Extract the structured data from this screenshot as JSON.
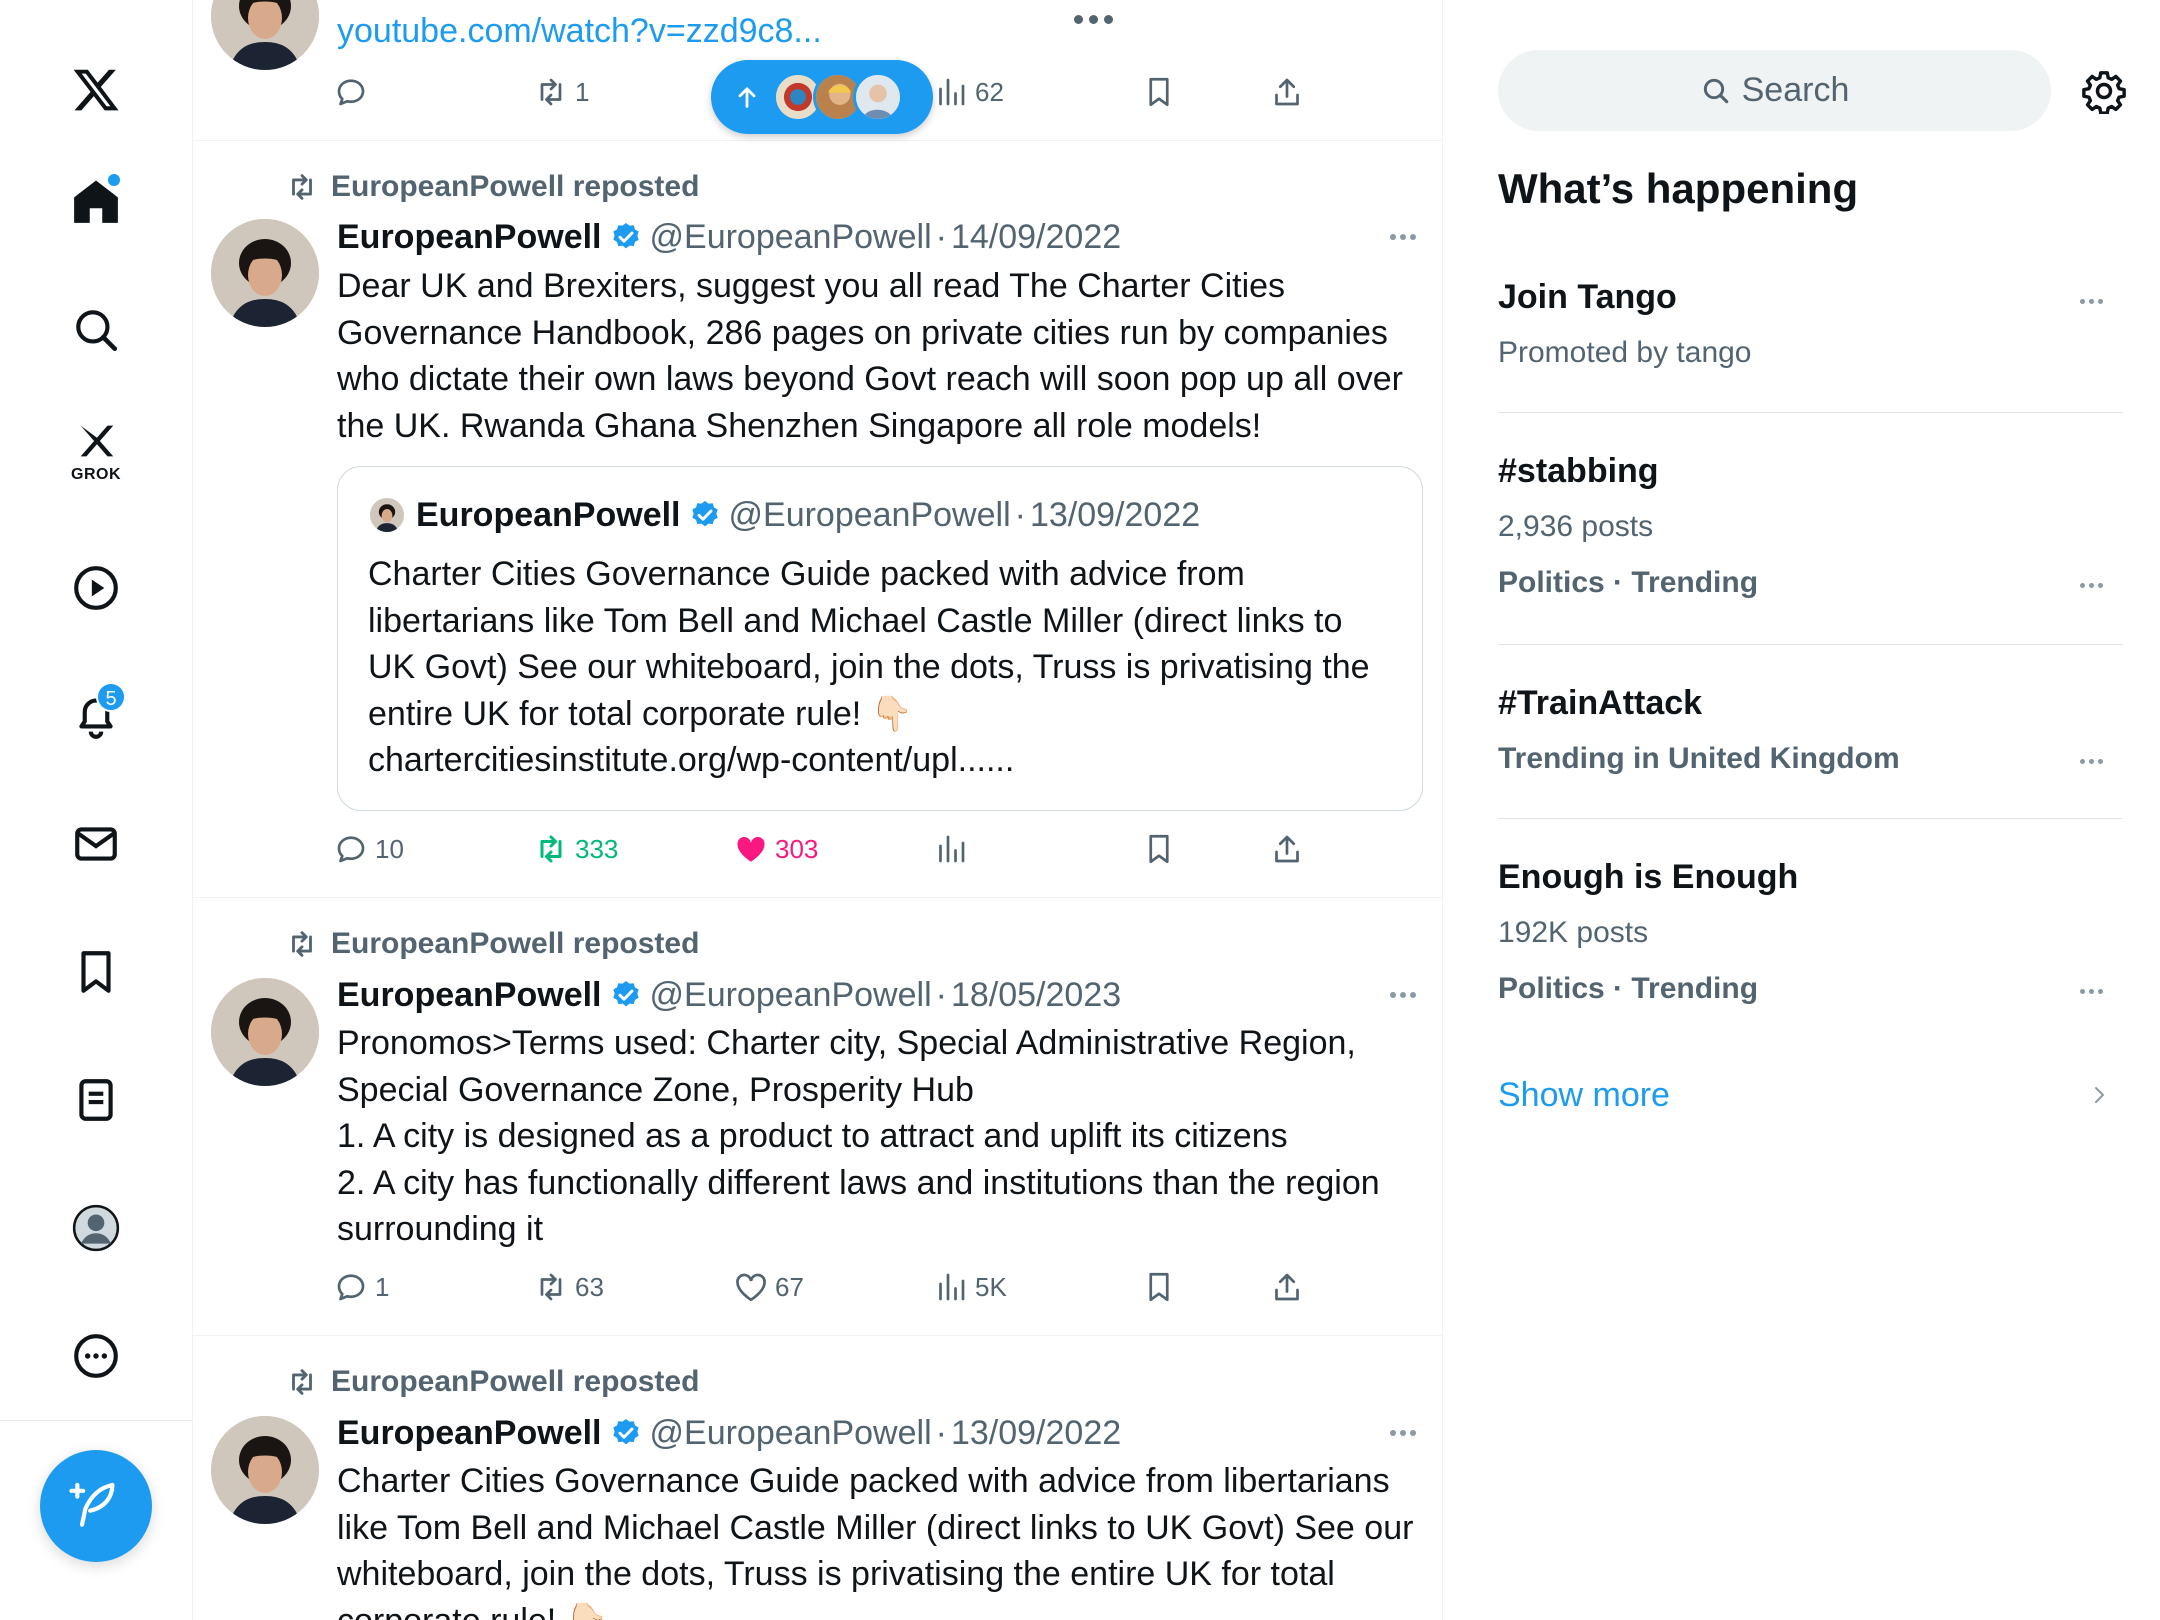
{
  "colors": {
    "accent": "#1d9bf0",
    "text": "#0f1419",
    "muted": "#536471",
    "repost": "#00ba7c",
    "like": "#f91880"
  },
  "nav": {
    "items": [
      {
        "name": "x-logo-icon"
      },
      {
        "name": "home-icon",
        "has_dot": true
      },
      {
        "name": "explore-search-icon"
      },
      {
        "name": "grok-icon",
        "label": "GROK"
      },
      {
        "name": "video-play-icon"
      },
      {
        "name": "notifications-bell-icon",
        "badge": "5"
      },
      {
        "name": "messages-envelope-icon"
      },
      {
        "name": "bookmarks-icon"
      },
      {
        "name": "lists-icon"
      },
      {
        "name": "profile-avatar-icon"
      },
      {
        "name": "more-ellipsis-icon"
      }
    ],
    "compose": {
      "icon": "feather-plus-icon"
    }
  },
  "timeline": {
    "top_post": {
      "link": "youtube.com/watch?v=zzd9c8...",
      "retweets": "1",
      "views": "62"
    },
    "new_posts_pill": {
      "icon": "arrow-up-icon"
    },
    "posts": [
      {
        "reposted_by": "EuropeanPowell reposted",
        "name": "EuropeanPowell",
        "handle": "@EuropeanPowell",
        "sep": "·",
        "date": "14/09/2022",
        "text": "Dear UK and Brexiters, suggest you all read The Charter Cities Governance Handbook, 286 pages on private cities run by companies who dictate their own laws beyond Govt reach will soon pop up all over the UK. Rwanda Ghana Shenzhen Singapore all role models!",
        "quote": {
          "name": "EuropeanPowell",
          "handle": "@EuropeanPowell",
          "sep": "·",
          "date": "13/09/2022",
          "text": "Charter Cities Governance Guide packed with advice from libertarians like Tom Bell and Michael Castle Miller (direct links to UK Govt) See our whiteboard, join the dots, Truss is privatising the entire UK for total corporate rule! 👇🏻",
          "link": "chartercitiesinstitute.org/wp-content/upl......"
        },
        "replies": "10",
        "retweets": "333",
        "likes": "303",
        "views": ""
      },
      {
        "reposted_by": "EuropeanPowell reposted",
        "name": "EuropeanPowell",
        "handle": "@EuropeanPowell",
        "sep": "·",
        "date": "18/05/2023",
        "lines": [
          "Pronomos>Terms used: Charter city, Special Administrative Region, Special Governance Zone, Prosperity Hub",
          "1. A city is designed as a product to attract and uplift its citizens",
          "2. A city has functionally different laws and institutions than the region surrounding it"
        ],
        "replies": "1",
        "retweets": "63",
        "likes": "67",
        "views": "5K"
      },
      {
        "reposted_by": "EuropeanPowell reposted",
        "name": "EuropeanPowell",
        "handle": "@EuropeanPowell",
        "sep": "·",
        "date": "13/09/2022",
        "text": "Charter Cities Governance Guide packed with advice from libertarians like Tom Bell and Michael Castle Miller (direct links to UK Govt) See our whiteboard, join the dots, Truss is privatising the entire UK for total corporate rule! 👇🏻"
      }
    ]
  },
  "sidebar": {
    "search_placeholder": "Search",
    "title": "What’s happening",
    "trends": [
      {
        "title": "Join Tango",
        "meta": "Promoted by tango"
      },
      {
        "title": "#stabbing",
        "count": "2,936 posts",
        "context": "Politics · Trending"
      },
      {
        "title": "#TrainAttack",
        "context": "Trending in United Kingdom"
      },
      {
        "title": "Enough is Enough",
        "count": "192K posts",
        "context": "Politics · Trending"
      }
    ],
    "show_more": "Show more"
  }
}
